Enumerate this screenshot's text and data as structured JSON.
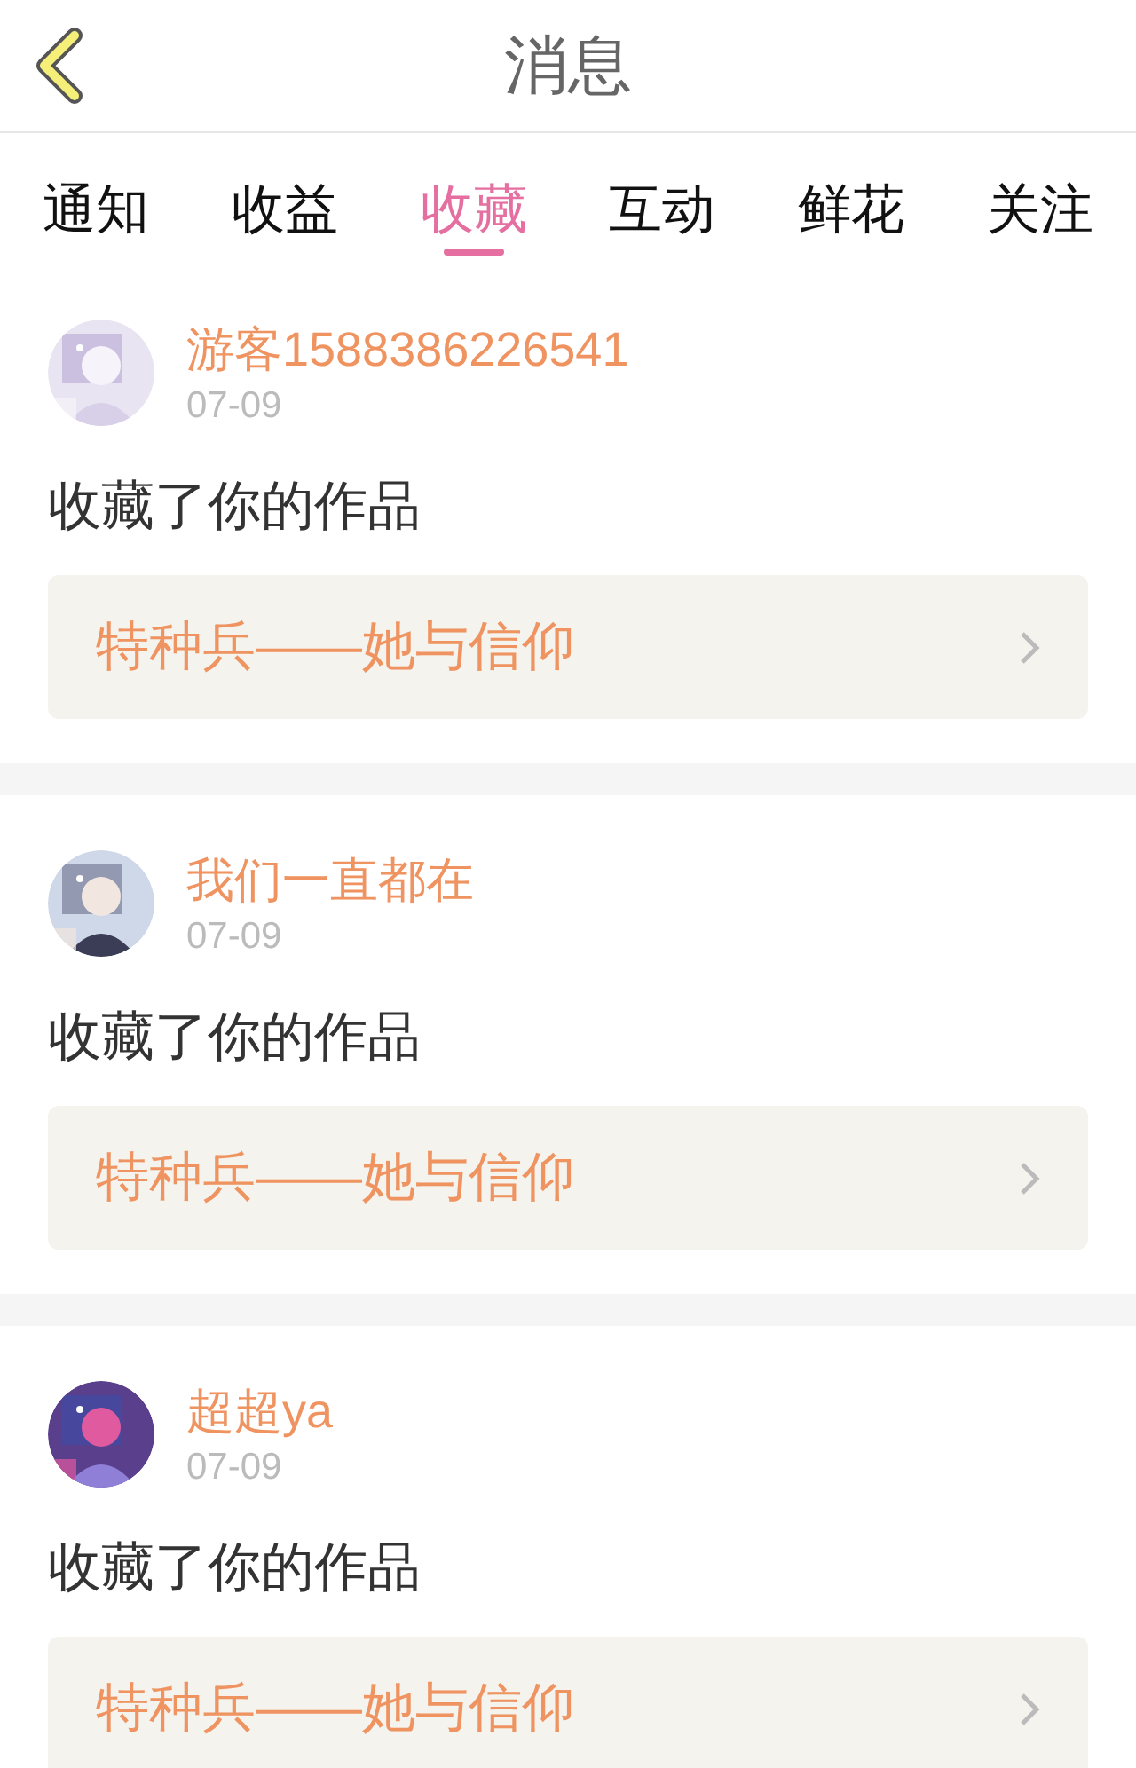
{
  "header": {
    "title": "消息"
  },
  "tabs": [
    {
      "label": "通知",
      "selected": false
    },
    {
      "label": "收益",
      "selected": false
    },
    {
      "label": "收藏",
      "selected": true
    },
    {
      "label": "互动",
      "selected": false
    },
    {
      "label": "鲜花",
      "selected": false
    },
    {
      "label": "关注",
      "selected": false
    }
  ],
  "messages": [
    {
      "user": "游客1588386226541",
      "date": "07-09",
      "action": "收藏了你的作品",
      "work": "特种兵——她与信仰"
    },
    {
      "user": "我们一直都在",
      "date": "07-09",
      "action": "收藏了你的作品",
      "work": "特种兵——她与信仰"
    },
    {
      "user": "超超ya",
      "date": "07-09",
      "action": "收藏了你的作品",
      "work": "特种兵——她与信仰"
    }
  ]
}
